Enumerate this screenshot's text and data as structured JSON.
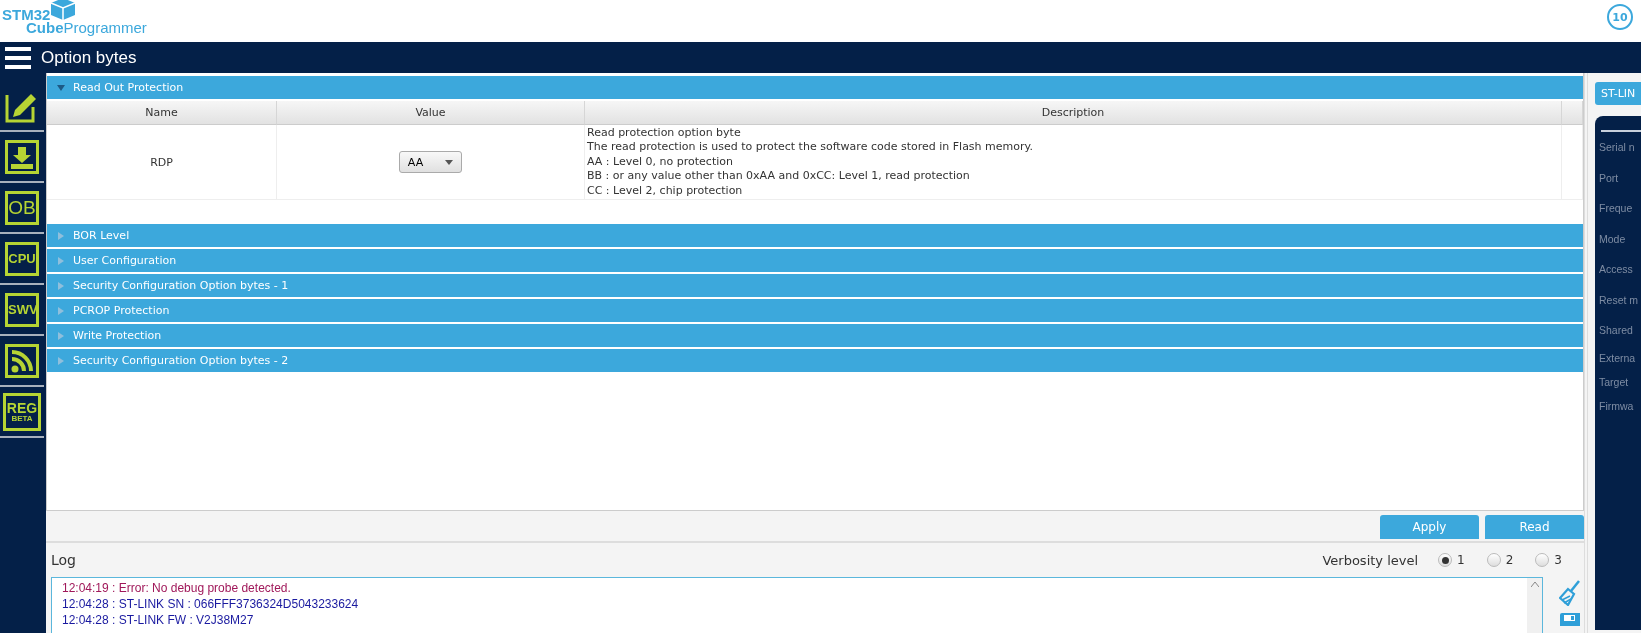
{
  "logo": {
    "line_1": "STM32",
    "line_2_bold": "Cube",
    "line_2": "Programmer",
    "badge": "10"
  },
  "header": {
    "title": "Option bytes"
  },
  "sidebar": {
    "items": [
      {
        "kind": "pencil"
      },
      {
        "kind": "download"
      },
      {
        "kind": "text",
        "label": "OB"
      },
      {
        "kind": "text",
        "label": "CPU"
      },
      {
        "kind": "text",
        "label": "SWV"
      },
      {
        "kind": "feed"
      },
      {
        "kind": "beta",
        "label": "REG",
        "sub": "BETA"
      }
    ]
  },
  "sections": [
    {
      "title": "Read Out Protection",
      "expanded": true,
      "table": {
        "columns": [
          "Name",
          "Value",
          "Description"
        ],
        "rows": [
          {
            "name": "RDP",
            "value": "AA",
            "description": [
              "Read protection option byte",
              "The read protection is used to protect the software code stored in Flash memory.",
              "AA : Level 0, no protection",
              "BB : or any value other than 0xAA and 0xCC: Level 1, read protection",
              "CC : Level 2, chip protection"
            ]
          }
        ]
      }
    },
    {
      "title": "BOR Level",
      "expanded": false
    },
    {
      "title": "User Configuration",
      "expanded": false
    },
    {
      "title": "Security Configuration Option bytes - 1",
      "expanded": false
    },
    {
      "title": "PCROP Protection",
      "expanded": false
    },
    {
      "title": "Write Protection",
      "expanded": false
    },
    {
      "title": "Security Configuration Option bytes - 2",
      "expanded": false
    }
  ],
  "buttons": [
    "Apply",
    "Read"
  ],
  "log": {
    "title": "Log",
    "verbosity_label": "Verbosity level",
    "verbosity": [
      {
        "label": "1",
        "selected": true
      },
      {
        "label": "2",
        "selected": false
      },
      {
        "label": "3",
        "selected": false
      }
    ],
    "lines": [
      {
        "kind": "error",
        "text": "12:04:19 : Error: No debug probe detected."
      },
      {
        "kind": "info",
        "text": "12:04:28 : ST-LINK SN  : 066FFF3736324D5043233624"
      },
      {
        "kind": "info",
        "text": "12:04:28 : ST-LINK FW  : V2J38M27"
      }
    ]
  },
  "right_panel": {
    "tab": "ST-LIN",
    "labels": [
      "Serial n",
      "Port",
      "Freque",
      "Mode",
      "Access",
      "Reset m",
      "Shared",
      "Externa",
      "Target",
      "Firmwa"
    ]
  }
}
